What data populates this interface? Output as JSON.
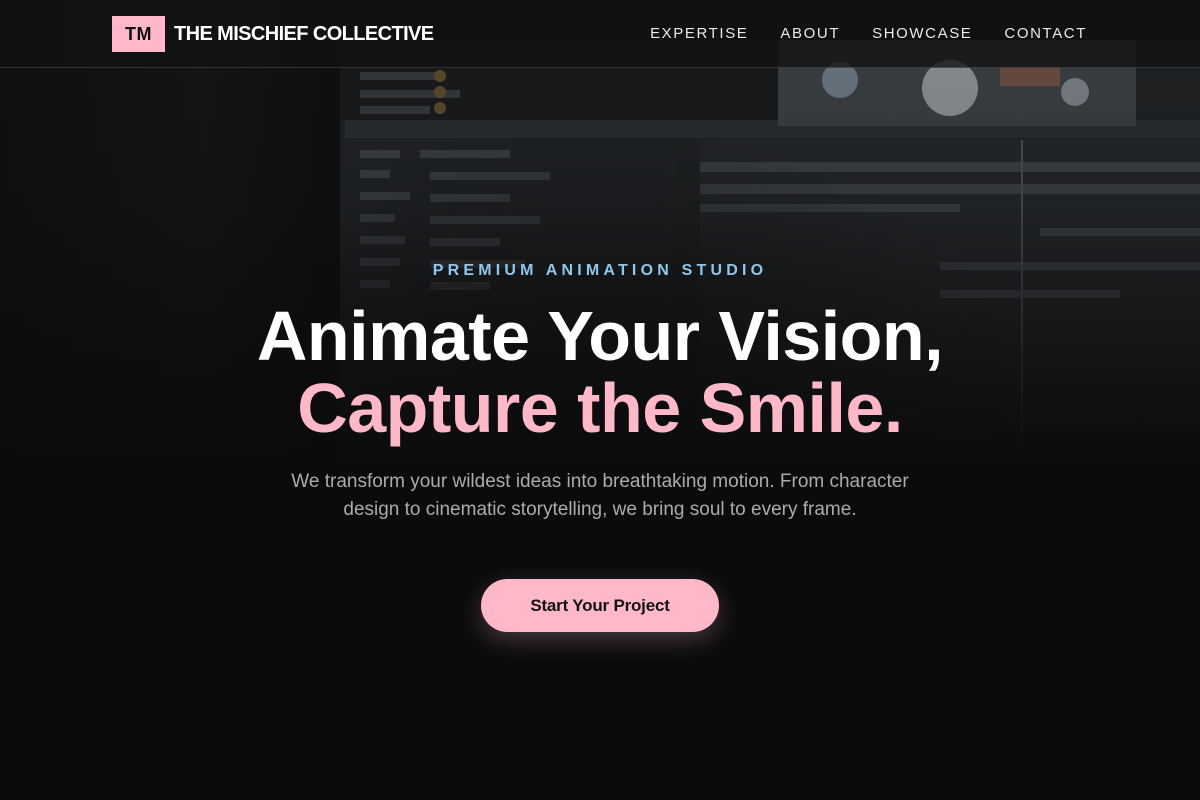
{
  "header": {
    "logo_mark": "TM",
    "brand_name": "THE MISCHIEF COLLECTIVE",
    "nav": [
      {
        "label": "EXPERTISE"
      },
      {
        "label": "ABOUT"
      },
      {
        "label": "SHOWCASE"
      },
      {
        "label": "CONTACT"
      }
    ]
  },
  "hero": {
    "eyebrow": "PREMIUM ANIMATION STUDIO",
    "headline_line1": "Animate Your Vision,",
    "headline_line2": "Capture the Smile.",
    "subtext": "We transform your wildest ideas into breathtaking motion. From character design to cinematic storytelling, we bring soul to every frame.",
    "cta_label": "Start Your Project"
  },
  "colors": {
    "accent_pink": "#ffb8c8",
    "eyebrow_blue": "#8fc7ec",
    "background": "#0b0b0c"
  }
}
